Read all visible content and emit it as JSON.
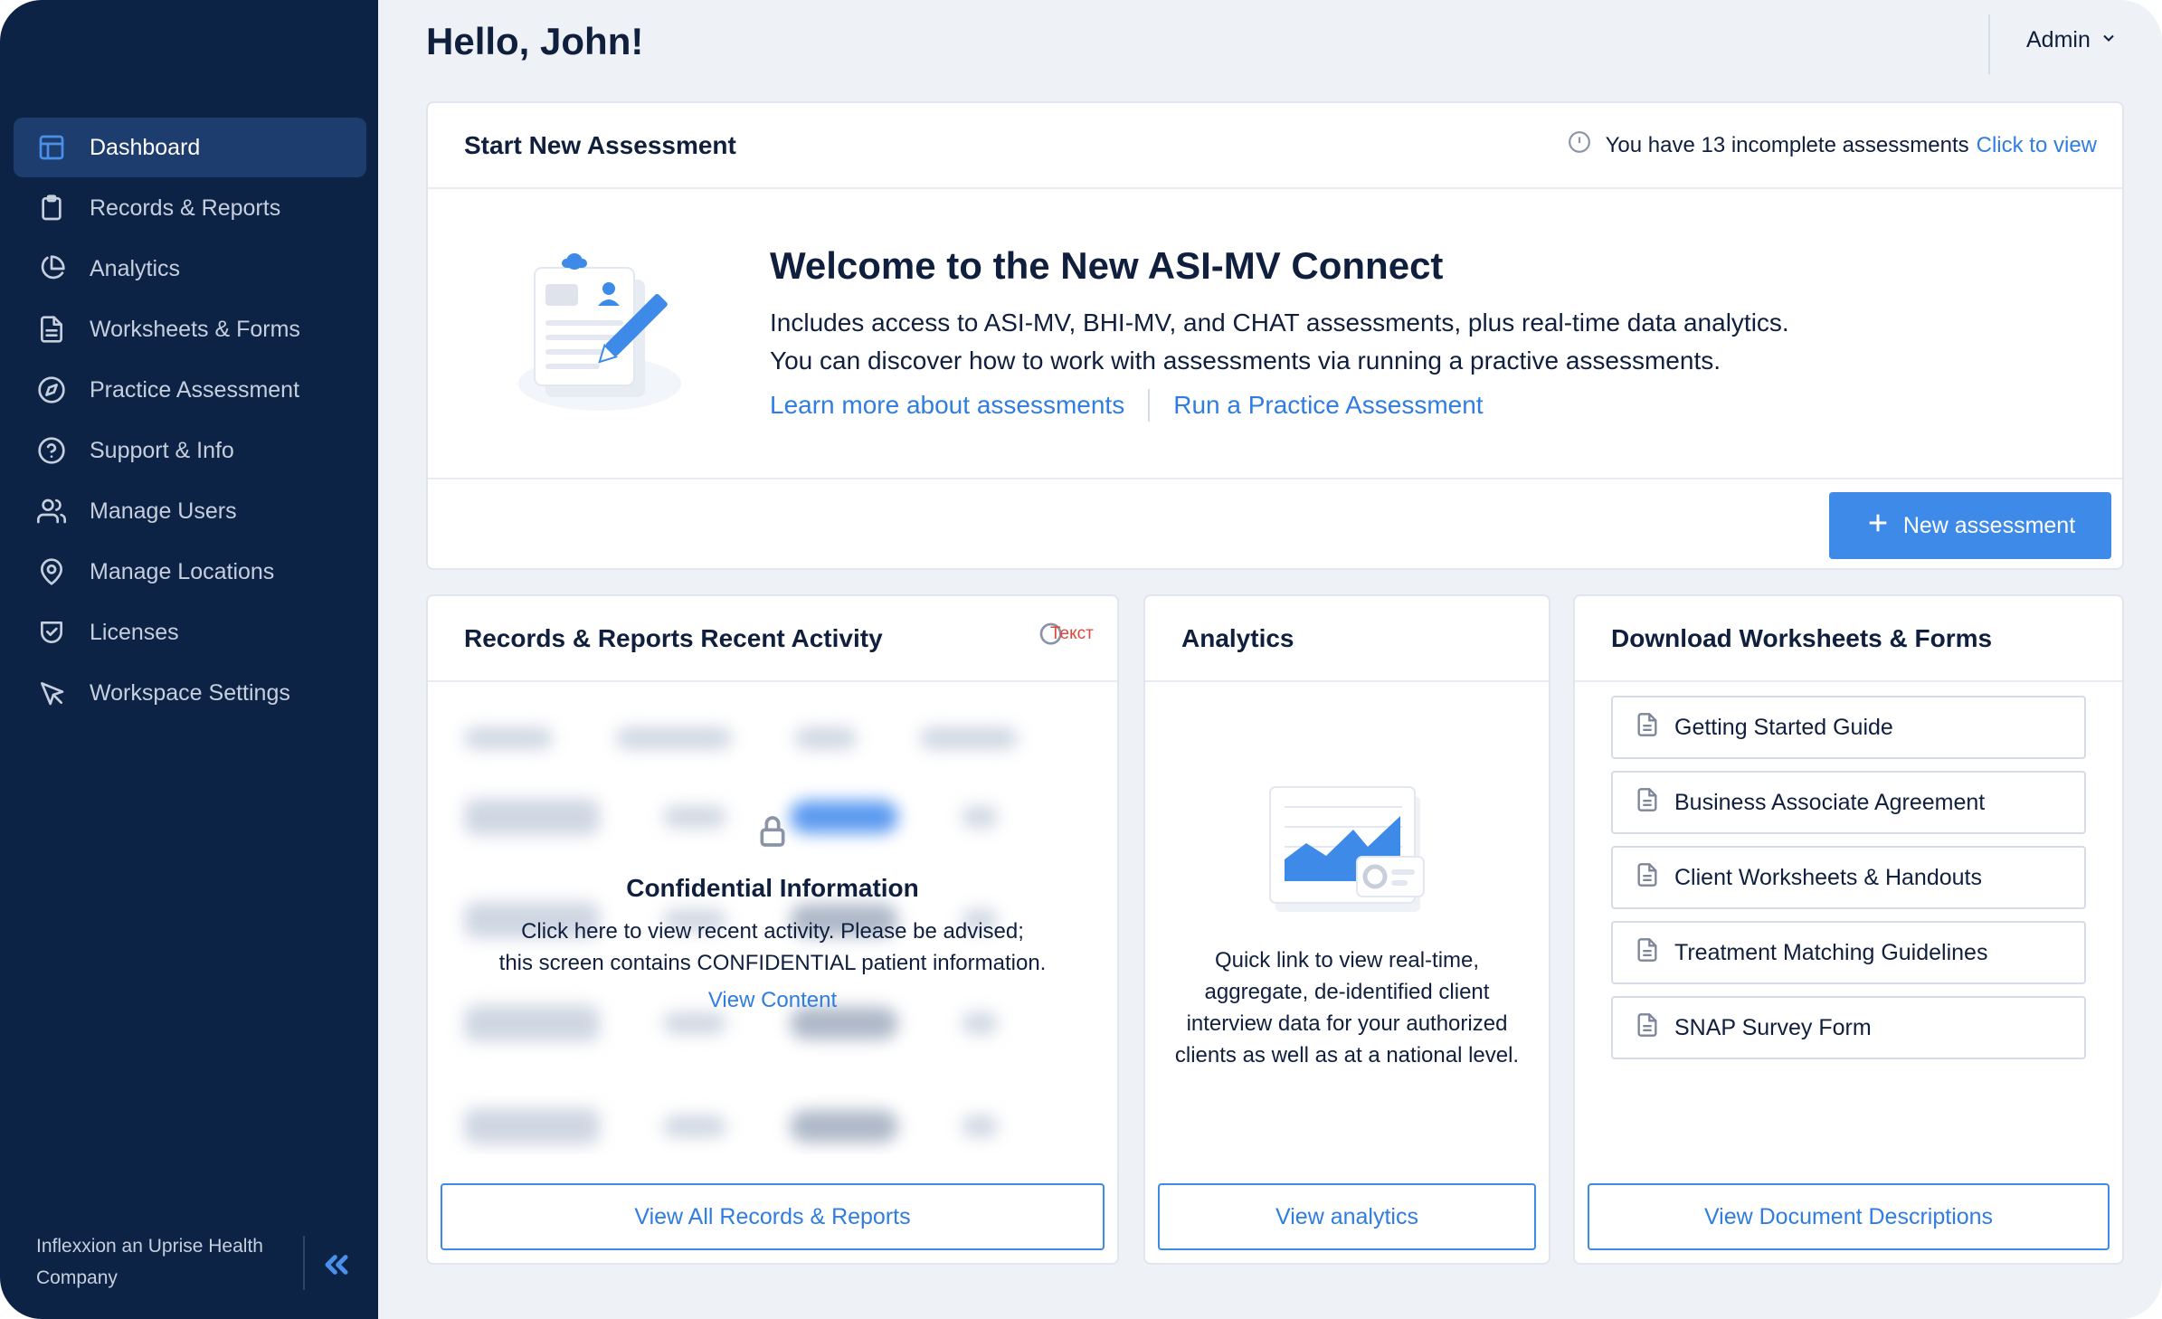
{
  "app": {
    "page_title": "Hello, John!",
    "user_menu": "Admin"
  },
  "sidebar": {
    "items": [
      {
        "label": "Dashboard",
        "icon": "layout-icon",
        "active": true
      },
      {
        "label": "Records & Reports",
        "icon": "clipboard-icon"
      },
      {
        "label": "Analytics",
        "icon": "pie-chart-icon"
      },
      {
        "label": "Worksheets & Forms",
        "icon": "document-icon"
      },
      {
        "label": "Practice Assessment",
        "icon": "compass-icon"
      },
      {
        "label": "Support & Info",
        "icon": "help-circle-icon"
      },
      {
        "label": "Manage Users",
        "icon": "users-icon"
      },
      {
        "label": "Manage Locations",
        "icon": "map-pin-icon"
      },
      {
        "label": "Licenses",
        "icon": "shield-check-icon"
      },
      {
        "label": "Workspace Settings",
        "icon": "cursor-icon"
      }
    ],
    "footer": "Inflexxion an Uprise Health Company",
    "collapse_icon": "chevrons-left-icon"
  },
  "assessment": {
    "title": "Start New Assessment",
    "incomplete_text": "You have 13 incomplete assessments",
    "incomplete_link": "Click to view",
    "welcome_title": "Welcome to the New ASI-MV Connect",
    "welcome_line1": "Includes access to ASI-MV, BHI-MV, and CHAT assessments, plus real-time data analytics.",
    "welcome_line2": "You can discover how to work with assessments via running a practive assessments.",
    "link_learn": "Learn more about assessments",
    "link_practice": "Run a Practice Assessment",
    "new_button": "New assessment"
  },
  "records": {
    "title": "Records & Reports Recent Activity",
    "badge_text": "Текст",
    "conf_title": "Confidential Information",
    "conf_line1": "Click here to view recent activity. Please be advised;",
    "conf_line2": "this screen contains CONFIDENTIAL patient information.",
    "conf_link": "View Content",
    "button": "View All Records & Reports"
  },
  "analytics": {
    "title": "Analytics",
    "text": "Quick link to view real-time, aggregate, de-identified client interview data for your authorized clients as well as at a national level.",
    "button": "View analytics"
  },
  "downloads": {
    "title": "Download Worksheets & Forms",
    "items": [
      "Getting Started Guide",
      "Business Associate Agreement",
      "Client Worksheets & Handouts",
      "Treatment Matching Guidelines",
      "SNAP Survey Form"
    ],
    "button": "View Document Descriptions"
  },
  "colors": {
    "sidebar_bg": "#0d2346",
    "accent": "#3d8ae8",
    "page_bg": "#eef1f6"
  }
}
